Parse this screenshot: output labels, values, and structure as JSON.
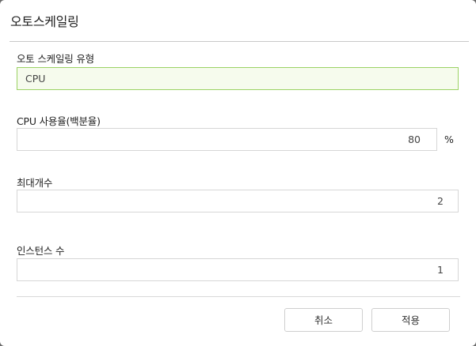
{
  "dialog": {
    "title": "오토스케일링"
  },
  "form": {
    "type": {
      "label": "오토 스케일링 유형",
      "value": "CPU"
    },
    "cpu_usage": {
      "label": "CPU 사용율(백분율)",
      "value": "80",
      "unit": "%"
    },
    "max_count": {
      "label": "최대개수",
      "value": "2"
    },
    "instances": {
      "label": "인스턴스 수",
      "value": "1"
    }
  },
  "buttons": {
    "cancel_label": "취소",
    "apply_label": "적용"
  },
  "colors": {
    "accent_border": "#9bd264",
    "accent_fill": "#f6fbed"
  }
}
